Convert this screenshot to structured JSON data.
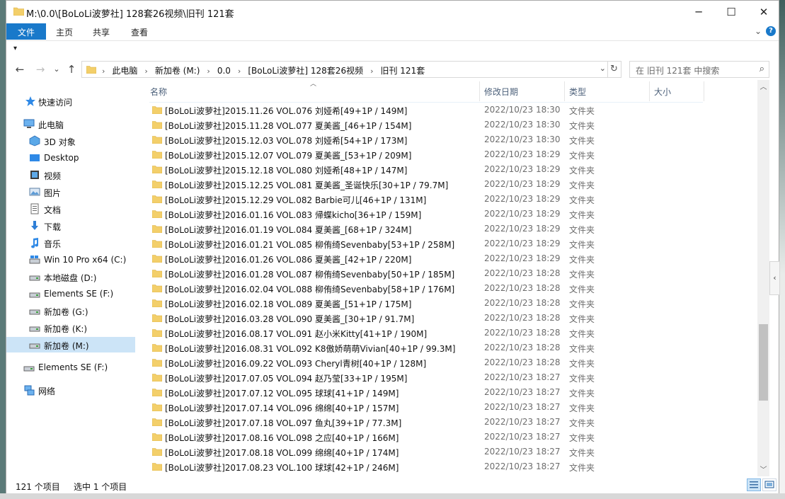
{
  "window": {
    "title": "M:\\0.0\\[BoLoLi波萝社] 128套26视频\\旧刊 121套",
    "minimize_icon": "─",
    "maximize_icon": "☐",
    "close_icon": "✕"
  },
  "ribbon": {
    "tabs": [
      "文件",
      "主页",
      "共享",
      "查看"
    ],
    "active_tab": "文件"
  },
  "address": {
    "breadcrumbs": [
      "此电脑",
      "新加卷 (M:)",
      "0.0",
      "[BoLoLi波萝社] 128套26视频",
      "旧刊 121套"
    ]
  },
  "search": {
    "placeholder": "在 旧刊 121套 中搜索"
  },
  "nav": {
    "items": [
      {
        "label": "快速访问",
        "icon": "star-icon"
      },
      {
        "label": "此电脑",
        "icon": "computer-icon"
      },
      {
        "label": "3D 对象",
        "icon": "3d-objects-icon"
      },
      {
        "label": "Desktop",
        "icon": "desktop-icon"
      },
      {
        "label": "视频",
        "icon": "video-icon"
      },
      {
        "label": "图片",
        "icon": "pictures-icon"
      },
      {
        "label": "文档",
        "icon": "documents-icon"
      },
      {
        "label": "下载",
        "icon": "download-icon"
      },
      {
        "label": "音乐",
        "icon": "music-icon"
      },
      {
        "label": "Win 10 Pro x64 (C:)",
        "icon": "system-drive-icon"
      },
      {
        "label": "本地磁盘 (D:)",
        "icon": "drive-icon"
      },
      {
        "label": "Elements SE (F:)",
        "icon": "drive-icon"
      },
      {
        "label": "新加卷 (G:)",
        "icon": "drive-icon"
      },
      {
        "label": "新加卷 (K:)",
        "icon": "drive-icon"
      },
      {
        "label": "新加卷 (M:)",
        "icon": "drive-icon",
        "selected": true
      },
      {
        "label": "Elements SE (F:)",
        "icon": "drive-icon"
      },
      {
        "label": "网络",
        "icon": "network-icon"
      }
    ]
  },
  "columns": {
    "name": "名称",
    "date": "修改日期",
    "type": "类型",
    "size": "大小"
  },
  "files": [
    {
      "name": "[BoLoLi波萝社]2015.11.26 VOL.076 刘娅希[49+1P / 149M]",
      "date": "2022/10/23 18:30",
      "type": "文件夹"
    },
    {
      "name": "[BoLoLi波萝社]2015.11.28 VOL.077 夏美酱_[46+1P / 154M]",
      "date": "2022/10/23 18:30",
      "type": "文件夹"
    },
    {
      "name": "[BoLoLi波萝社]2015.12.03 VOL.078 刘娅希[54+1P / 173M]",
      "date": "2022/10/23 18:30",
      "type": "文件夹"
    },
    {
      "name": "[BoLoLi波萝社]2015.12.07 VOL.079 夏美酱_[53+1P / 209M]",
      "date": "2022/10/23 18:29",
      "type": "文件夹"
    },
    {
      "name": "[BoLoLi波萝社]2015.12.18 VOL.080 刘娅希[48+1P / 147M]",
      "date": "2022/10/23 18:29",
      "type": "文件夹"
    },
    {
      "name": "[BoLoLi波萝社]2015.12.25 VOL.081 夏美酱_圣诞快乐[30+1P / 79.7M]",
      "date": "2022/10/23 18:29",
      "type": "文件夹"
    },
    {
      "name": "[BoLoLi波萝社]2015.12.29 VOL.082 Barbie可儿[46+1P / 131M]",
      "date": "2022/10/23 18:29",
      "type": "文件夹"
    },
    {
      "name": "[BoLoLi波萝社]2016.01.16 VOL.083 帰蝶kicho[36+1P / 159M]",
      "date": "2022/10/23 18:29",
      "type": "文件夹"
    },
    {
      "name": "[BoLoLi波萝社]2016.01.19 VOL.084 夏美酱_[68+1P / 324M]",
      "date": "2022/10/23 18:29",
      "type": "文件夹"
    },
    {
      "name": "[BoLoLi波萝社]2016.01.21 VOL.085 柳侑绮Sevenbaby[53+1P / 258M]",
      "date": "2022/10/23 18:29",
      "type": "文件夹"
    },
    {
      "name": "[BoLoLi波萝社]2016.01.26 VOL.086 夏美酱_[42+1P / 220M]",
      "date": "2022/10/23 18:29",
      "type": "文件夹"
    },
    {
      "name": "[BoLoLi波萝社]2016.01.28 VOL.087 柳侑绮Sevenbaby[50+1P / 185M]",
      "date": "2022/10/23 18:28",
      "type": "文件夹"
    },
    {
      "name": "[BoLoLi波萝社]2016.02.04 VOL.088 柳侑绮Sevenbaby[58+1P / 176M]",
      "date": "2022/10/23 18:28",
      "type": "文件夹"
    },
    {
      "name": "[BoLoLi波萝社]2016.02.18 VOL.089 夏美酱_[51+1P / 175M]",
      "date": "2022/10/23 18:28",
      "type": "文件夹"
    },
    {
      "name": "[BoLoLi波萝社]2016.03.28 VOL.090 夏美酱_[30+1P / 91.7M]",
      "date": "2022/10/23 18:28",
      "type": "文件夹"
    },
    {
      "name": "[BoLoLi波萝社]2016.08.17 VOL.091 赵小米Kitty[41+1P / 190M]",
      "date": "2022/10/23 18:28",
      "type": "文件夹"
    },
    {
      "name": "[BoLoLi波萝社]2016.08.31 VOL.092 K8傲娇萌萌Vivian[40+1P / 99.3M]",
      "date": "2022/10/23 18:28",
      "type": "文件夹"
    },
    {
      "name": "[BoLoLi波萝社]2016.09.22 VOL.093 Cheryl青树[40+1P / 128M]",
      "date": "2022/10/23 18:28",
      "type": "文件夹"
    },
    {
      "name": "[BoLoLi波萝社]2017.07.05 VOL.094 赵乃莹[33+1P / 195M]",
      "date": "2022/10/23 18:27",
      "type": "文件夹"
    },
    {
      "name": "[BoLoLi波萝社]2017.07.12 VOL.095 球球[41+1P / 149M]",
      "date": "2022/10/23 18:27",
      "type": "文件夹"
    },
    {
      "name": "[BoLoLi波萝社]2017.07.14 VOL.096 绵绵[40+1P / 157M]",
      "date": "2022/10/23 18:27",
      "type": "文件夹"
    },
    {
      "name": "[BoLoLi波萝社]2017.07.18 VOL.097 鱼丸[39+1P / 77.3M]",
      "date": "2022/10/23 18:27",
      "type": "文件夹"
    },
    {
      "name": "[BoLoLi波萝社]2017.08.16 VOL.098 之应[40+1P / 166M]",
      "date": "2022/10/23 18:27",
      "type": "文件夹"
    },
    {
      "name": "[BoLoLi波萝社]2017.08.18 VOL.099 绵绵[40+1P / 174M]",
      "date": "2022/10/23 18:27",
      "type": "文件夹"
    },
    {
      "name": "[BoLoLi波萝社]2017.08.23 VOL.100 球球[42+1P / 246M]",
      "date": "2022/10/23 18:27",
      "type": "文件夹"
    }
  ],
  "status": {
    "item_count": "121 个项目",
    "selected": "选中 1 个项目"
  },
  "colors": {
    "accent": "#1979ca",
    "folder": "#f3cf6a",
    "selection": "#cce4f7"
  }
}
